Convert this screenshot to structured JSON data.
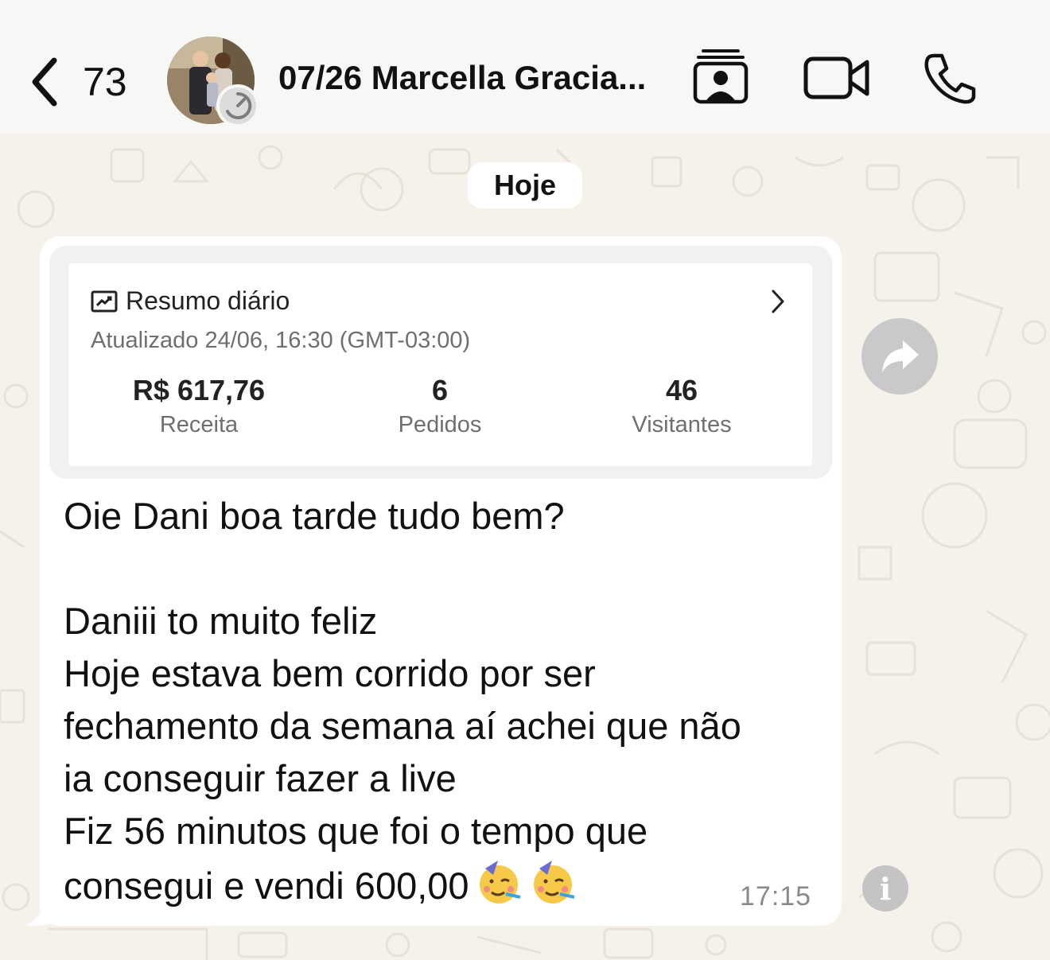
{
  "header": {
    "back_count": "73",
    "contact_name": "07/26 Marcella Gracia...",
    "icons": [
      "chevron-left-icon",
      "contact-card-icon",
      "video-camera-icon",
      "phone-icon"
    ]
  },
  "chat": {
    "date_label": "Hoje",
    "card": {
      "title": "Resumo diário",
      "updated": "Atualizado 24/06, 16:30 (GMT-03:00)",
      "metrics": [
        {
          "value": "R$ 617,76",
          "label": "Receita"
        },
        {
          "value": "6",
          "label": "Pedidos"
        },
        {
          "value": "46",
          "label": "Visitantes"
        }
      ]
    },
    "message": "Oie Dani boa tarde tudo bem?\n\nDaniii to muito feliz\nHoje estava bem corrido por ser\nfechamento da semana aí achei que não\nia conseguir fazer a live\nFiz 56 minutos que foi o tempo que\nconsegui e vendi 600,00",
    "timestamp": "17:15",
    "emojis": [
      "partying-face",
      "partying-face"
    ]
  },
  "colors": {
    "background": "#f5f2ec",
    "bubble": "#ffffff",
    "header": "#f7f7f5"
  }
}
